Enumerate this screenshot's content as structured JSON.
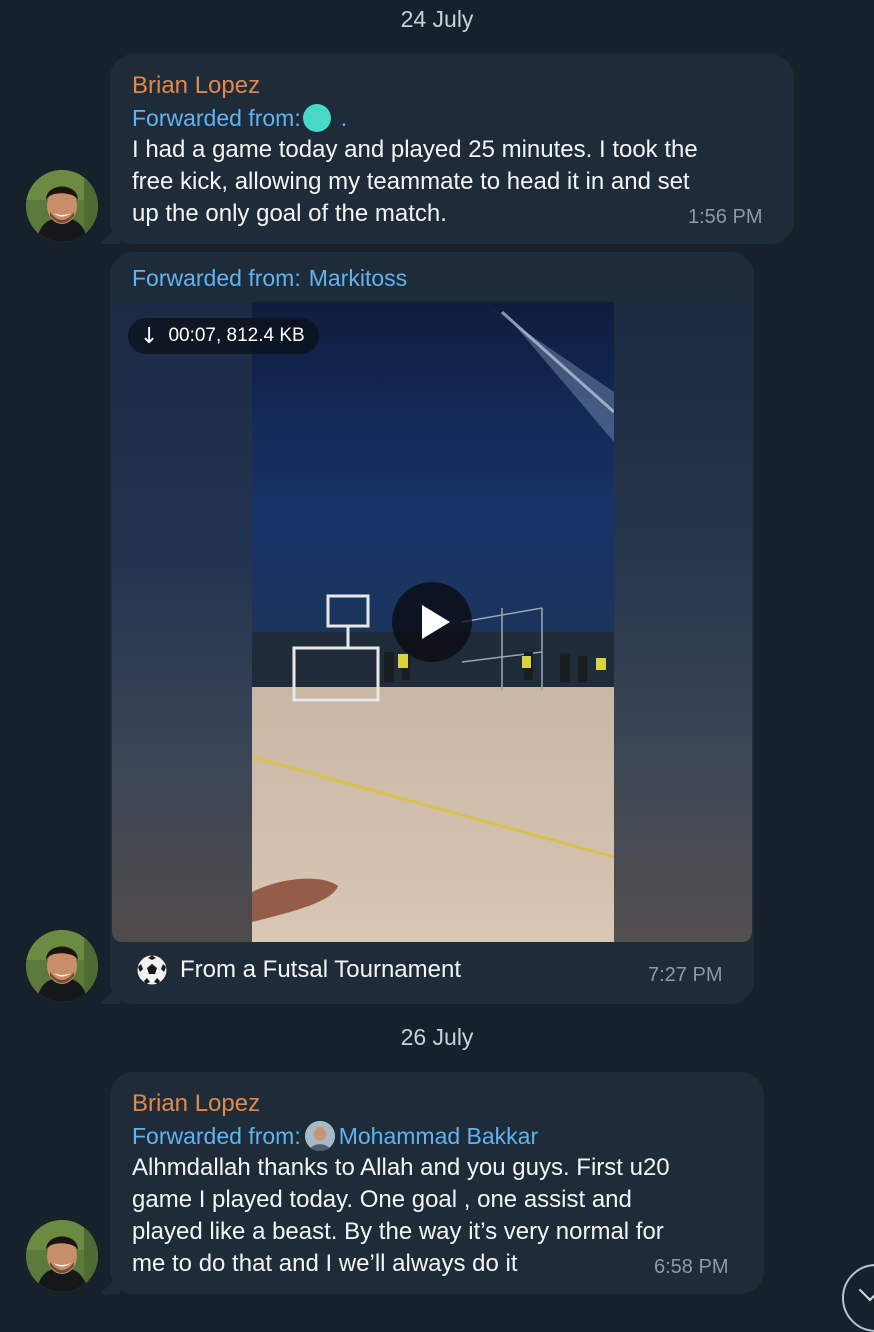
{
  "dates": {
    "first": "24 July",
    "second": "26 July"
  },
  "messages": [
    {
      "sender": "Brian Lopez",
      "forwarded_label": "Forwarded from:",
      "forwarded_from": ".",
      "text": "I had a game today and played 25 minutes. I took the\nfree kick, allowing my teammate to head it in and set\nup the only goal of the match.",
      "time": "1:56 PM"
    },
    {
      "forwarded_label": "Forwarded from:",
      "forwarded_from": "Markitoss",
      "video_badge": "00:07, 812.4 KB",
      "caption": "From a Futsal Tournament",
      "time": "7:27 PM"
    },
    {
      "sender": "Brian Lopez",
      "forwarded_label": "Forwarded from:",
      "forwarded_from": "Mohammad Bakkar",
      "text": "Alhmdallah thanks to Allah and you guys. First u20\ngame I played today. One goal , one assist and\nplayed like a beast. By the way it’s very normal for\nme to do that and I we’ll always do it",
      "time": "6:58 PM"
    }
  ],
  "icons": {
    "download": "arrow-down-icon",
    "play": "play-icon",
    "ball": "soccer-ball-icon",
    "scroll": "chevron-down-icon"
  },
  "colors": {
    "background": "#17212b",
    "bubble": "#1e2c3a",
    "sender": "#e3884a",
    "forwarded": "#61b3f0",
    "time": "#8b99a8"
  }
}
